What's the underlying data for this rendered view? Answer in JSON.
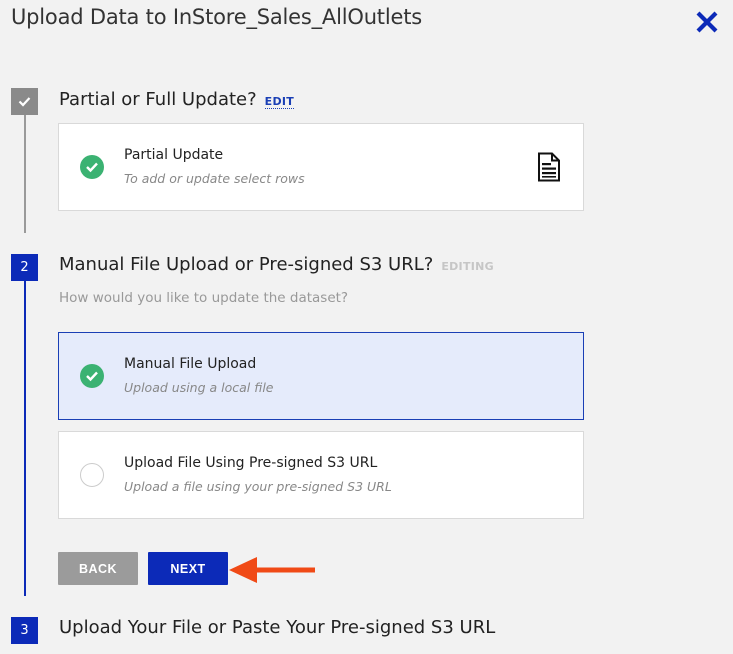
{
  "dialog": {
    "title": "Upload Data to InStore_Sales_AllOutlets",
    "close_icon": "close-icon"
  },
  "colors": {
    "accent": "#0c2ab8",
    "success": "#3bb272",
    "done_marker": "#8a8a8a",
    "annotation_arrow": "#f04a16"
  },
  "steps": [
    {
      "number": "",
      "icon": "checkmark-icon",
      "state": "done",
      "title": "Partial or Full Update?",
      "action_label": "EDIT",
      "selected_option": {
        "label": "Partial Update",
        "description": "To add or update select rows",
        "status_icon": "check-circle-icon",
        "trailing_icon": "document-icon"
      }
    },
    {
      "number": "2",
      "state": "editing",
      "title": "Manual File Upload or Pre-signed S3 URL?",
      "status_label": "EDITING",
      "question": "How would you like to update the dataset?",
      "options": [
        {
          "label": "Manual File Upload",
          "description": "Upload using a local file",
          "selected": true,
          "icon": "check-circle-icon"
        },
        {
          "label": "Upload File Using Pre-signed S3 URL",
          "description": "Upload a file using your pre-signed S3 URL",
          "selected": false,
          "icon": "radio-empty-icon"
        }
      ],
      "buttons": {
        "back": "BACK",
        "next": "NEXT"
      }
    },
    {
      "number": "3",
      "state": "pending",
      "title": "Upload Your File or Paste Your Pre-signed S3 URL"
    }
  ]
}
